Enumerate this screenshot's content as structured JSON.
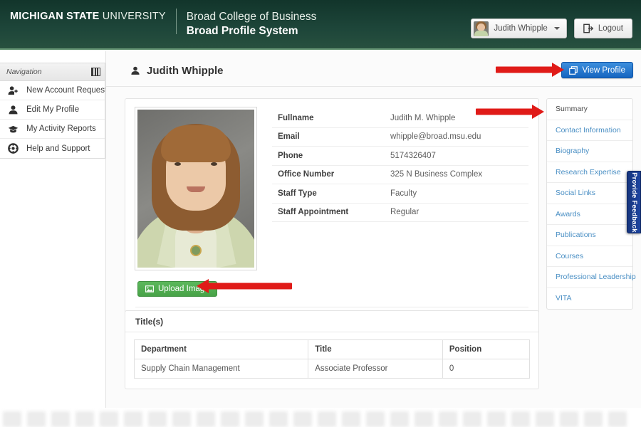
{
  "header": {
    "university_bold": "MICHIGAN STATE",
    "university_light": "UNIVERSITY",
    "college": "Broad College of Business",
    "system": "Broad Profile System",
    "user_name": "Judith Whipple",
    "logout_label": "Logout",
    "background_color": "#1d4539",
    "accent_color": "#6f9e7c"
  },
  "sidebar": {
    "heading": "Navigation",
    "items": [
      {
        "label": "New Account Request",
        "icon": "user-plus-icon"
      },
      {
        "label": "Edit My Profile",
        "icon": "user-icon"
      },
      {
        "label": "My Activity Reports",
        "icon": "graduation-cap-icon"
      },
      {
        "label": "Help and Support",
        "icon": "lifebuoy-icon"
      }
    ]
  },
  "page": {
    "title": "Judith Whipple",
    "view_profile_label": "View Profile",
    "view_profile_color": "#1565c0"
  },
  "profile": {
    "upload_label": "Upload Image",
    "upload_color": "#5cb85c",
    "fields": [
      {
        "label": "Fullname",
        "value": "Judith M. Whipple"
      },
      {
        "label": "Email",
        "value": "whipple@broad.msu.edu"
      },
      {
        "label": "Phone",
        "value": "5174326407"
      },
      {
        "label": "Office Number",
        "value": "325 N Business Complex"
      },
      {
        "label": "Staff Type",
        "value": "Faculty"
      },
      {
        "label": "Staff Appointment",
        "value": "Regular"
      }
    ]
  },
  "titles_card": {
    "heading": "Title(s)",
    "columns": [
      "Department",
      "Title",
      "Position"
    ],
    "rows": [
      [
        "Supply Chain Management",
        "Associate Professor",
        "0"
      ]
    ]
  },
  "right_panel": {
    "items": [
      {
        "label": "Summary",
        "active": true
      },
      {
        "label": "Contact Information",
        "active": false
      },
      {
        "label": "Biography",
        "active": false
      },
      {
        "label": "Research Expertise",
        "active": false
      },
      {
        "label": "Social Links",
        "active": false
      },
      {
        "label": "Awards",
        "active": false
      },
      {
        "label": "Publications",
        "active": false
      },
      {
        "label": "Courses",
        "active": false
      },
      {
        "label": "Professional Leadership",
        "active": false
      },
      {
        "label": "VITA",
        "active": false
      }
    ],
    "link_color": "#4a8fc4"
  },
  "feedback_tab": {
    "label": "Provide Feedback",
    "color": "#1d44a0"
  },
  "annotations": {
    "color": "#e01b18",
    "arrows": [
      {
        "target": "view-profile-button",
        "direction": "right"
      },
      {
        "target": "summary-panel-item",
        "direction": "right"
      },
      {
        "target": "upload-image-button",
        "direction": "left"
      }
    ]
  }
}
